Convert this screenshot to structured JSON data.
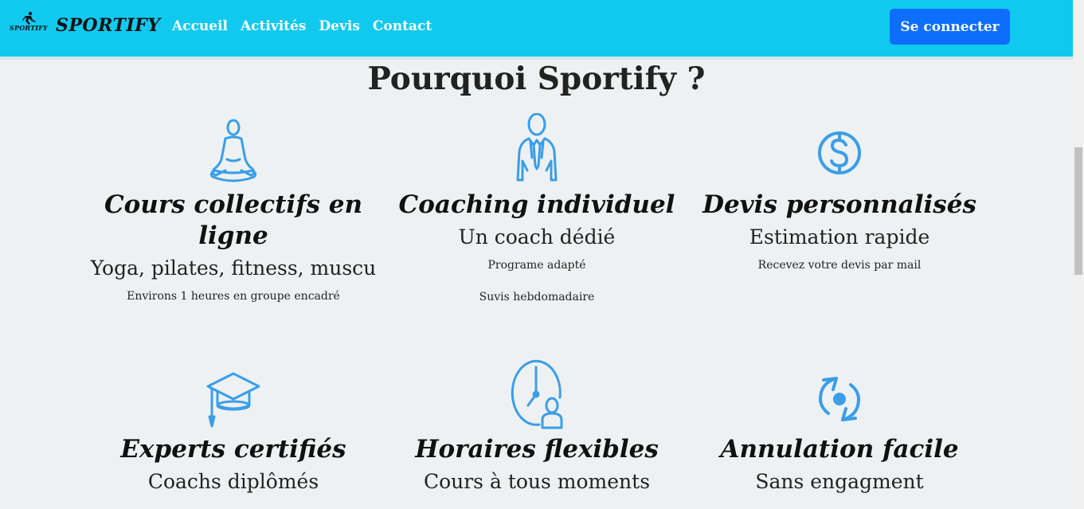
{
  "nav": {
    "logo_text": "SPORTIFY",
    "brand": "SPORTIFY",
    "links": [
      "Accueil",
      "Activités",
      "Devis",
      "Contact"
    ],
    "login": "Se connecter"
  },
  "page": {
    "title": "Pourquoi Sportify ?"
  },
  "features": [
    {
      "title": "Cours collectifs en ligne",
      "subtitle": "Yoga, pilates, fitness, muscu",
      "lines": [
        "Environs 1 heures en groupe encadré"
      ],
      "icon": "meditation-icon"
    },
    {
      "title": "Coaching individuel",
      "subtitle": "Un coach dédié",
      "lines": [
        "Programe adapté",
        "Suvis hebdomadaire"
      ],
      "icon": "coach-icon"
    },
    {
      "title": "Devis personnalisés",
      "subtitle": "Estimation rapide",
      "lines": [
        "Recevez votre devis par mail"
      ],
      "icon": "dollar-icon"
    },
    {
      "title": "Experts certifiés",
      "subtitle": "Coachs diplômés",
      "lines": [],
      "icon": "graduation-cap-icon"
    },
    {
      "title": "Horaires flexibles",
      "subtitle": "Cours à tous moments",
      "lines": [],
      "icon": "clock-person-icon"
    },
    {
      "title": "Annulation facile",
      "subtitle": "Sans engagment",
      "lines": [],
      "icon": "refresh-icon"
    }
  ],
  "colors": {
    "navbar": "#10c9ef",
    "button": "#0d6efd",
    "icon": "#3a9ee8",
    "background": "#eef1f2"
  }
}
